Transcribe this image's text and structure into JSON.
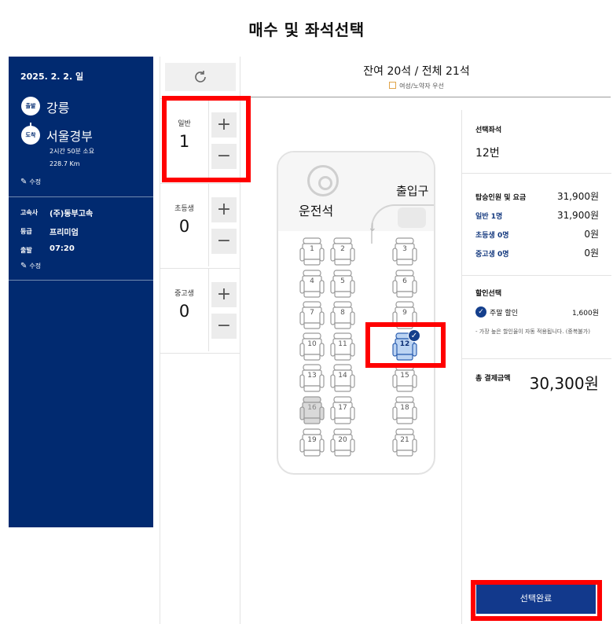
{
  "page_title": "매수 및 좌석선택",
  "trip": {
    "date": "2025. 2. 2. 일",
    "departure_badge": "출발",
    "departure": "강릉",
    "arrival_badge": "도착",
    "arrival": "서울경부",
    "duration": "2시간 50분 소요",
    "distance": "228.7 Km",
    "edit_label": "수정",
    "company_label": "고속사",
    "company": "(주)동부고속",
    "grade_label": "등급",
    "grade": "프리미엄",
    "depart_time_label": "출발",
    "depart_time": "07:20",
    "edit_label_2": "수정"
  },
  "passengers": [
    {
      "label": "일반",
      "count": "1",
      "plus": "+",
      "minus": "−"
    },
    {
      "label": "초등생",
      "count": "0",
      "plus": "+",
      "minus": "−"
    },
    {
      "label": "중고생",
      "count": "0",
      "plus": "+",
      "minus": "−"
    }
  ],
  "seat_header": {
    "remaining": "잔여 20석 / 전체 21석",
    "legend": "여성/노약자 우선"
  },
  "bus": {
    "driver_label": "운전석",
    "door_label": "출입구",
    "seats": [
      "1",
      "2",
      "3",
      "4",
      "5",
      "6",
      "7",
      "8",
      "9",
      "10",
      "11",
      "12",
      "13",
      "14",
      "15",
      "16",
      "17",
      "18",
      "19",
      "20",
      "21"
    ],
    "selected_seat": "12",
    "sold_seat": "16"
  },
  "summary": {
    "selected_seat_label": "선택좌석",
    "selected_seat": "12번",
    "fare_label": "탑승인원 및 요금",
    "fare_total": "31,900원",
    "fares": [
      {
        "label": "일반 1명",
        "value": "31,900원"
      },
      {
        "label": "초등생 0명",
        "value": "0원"
      },
      {
        "label": "중고생 0명",
        "value": "0원"
      }
    ],
    "discount_label": "할인선택",
    "discount_name": "주말 할인",
    "discount_amount": "1,600원",
    "discount_note": "- 가장 높은 할인율이 자동 적용됩니다. (중복불가)",
    "total_label": "총 결제금액",
    "total": "30,300원",
    "done_button": "선택완료"
  },
  "colors": {
    "navy": "#012a70",
    "button_blue": "#12398c",
    "highlight": "#ff0000"
  },
  "icons": [
    "refresh-icon",
    "pen-icon",
    "check-icon"
  ]
}
